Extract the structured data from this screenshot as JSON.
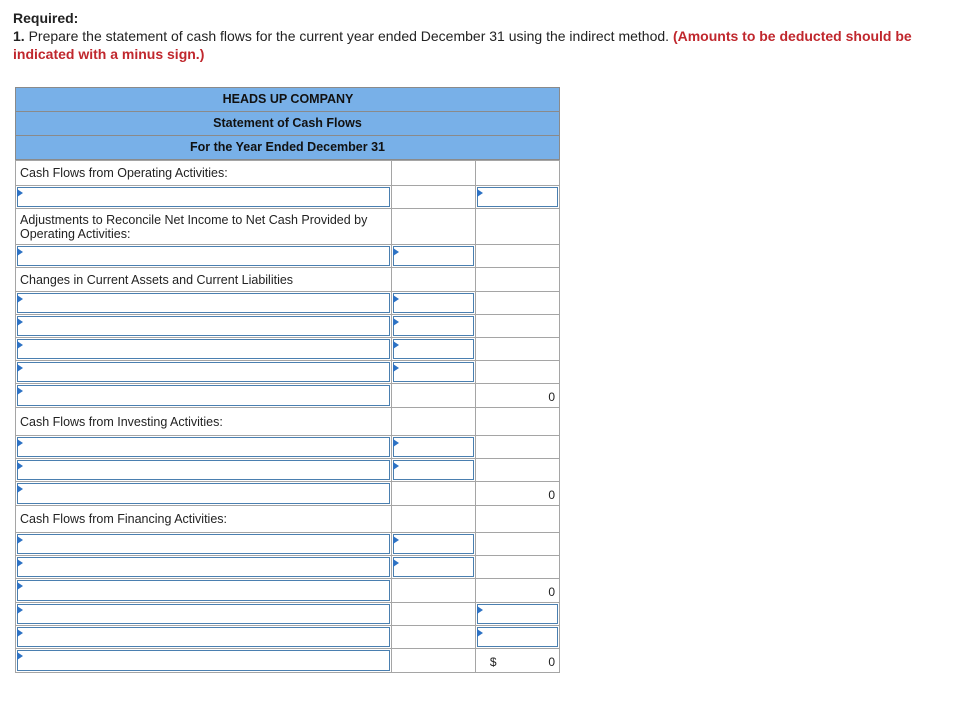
{
  "required": {
    "title": "Required:",
    "number": "1.",
    "instruction": "Prepare the statement of cash flows for the current year ended December 31 using the indirect method.",
    "note": "(Amounts to be deducted should be indicated with a minus sign.)"
  },
  "statement": {
    "company": "HEADS UP COMPANY",
    "title": "Statement of Cash Flows",
    "period": "For the Year Ended December 31"
  },
  "sections": {
    "operating": "Cash Flows from Operating Activities:",
    "adjustments": "Adjustments to Reconcile Net Income to Net Cash Provided by Operating Activities:",
    "changes": "Changes in Current Assets and Current Liabilities",
    "investing": "Cash Flows from Investing Activities:",
    "financing": "Cash Flows from Financing Activities:"
  },
  "totals": {
    "operating_total": "0",
    "investing_total": "0",
    "financing_total": "0",
    "currency": "$",
    "final_total": "0"
  }
}
